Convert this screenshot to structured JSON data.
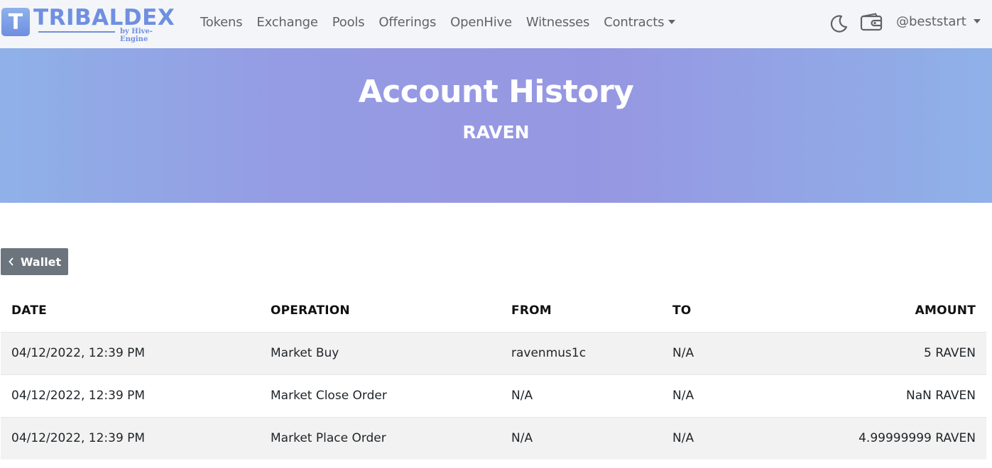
{
  "brand": {
    "badge_letter": "T",
    "name": "TRIBALDEX",
    "subtitle": "by Hive-Engine",
    "color": "#6f8fe0"
  },
  "nav": {
    "links": [
      "Tokens",
      "Exchange",
      "Pools",
      "Offerings",
      "OpenHive",
      "Witnesses",
      "Contracts"
    ],
    "dropdown_link": "Contracts",
    "theme_icon": "moon-icon",
    "wallet_icon": "wallet-icon",
    "user": "@beststart"
  },
  "hero": {
    "title": "Account History",
    "subtitle": "RAVEN"
  },
  "back_button": {
    "label": "Wallet",
    "icon": "chevron-left-icon"
  },
  "table": {
    "columns": [
      "DATE",
      "OPERATION",
      "FROM",
      "TO",
      "AMOUNT"
    ],
    "rows": [
      [
        "04/12/2022, 12:39 PM",
        "Market Buy",
        "ravenmus1c",
        "N/A",
        "5 RAVEN"
      ],
      [
        "04/12/2022, 12:39 PM",
        "Market Close Order",
        "N/A",
        "N/A",
        "NaN RAVEN"
      ],
      [
        "04/12/2022, 12:39 PM",
        "Market Place Order",
        "N/A",
        "N/A",
        "4.99999999 RAVEN"
      ]
    ]
  },
  "colors": {
    "navbar_bg": "#f3f5f8",
    "hero_gradient_start": "#8fb1e8",
    "hero_gradient_mid": "#9697e2",
    "button_bg": "#6c757d",
    "stripe_bg": "#f2f2f2"
  }
}
